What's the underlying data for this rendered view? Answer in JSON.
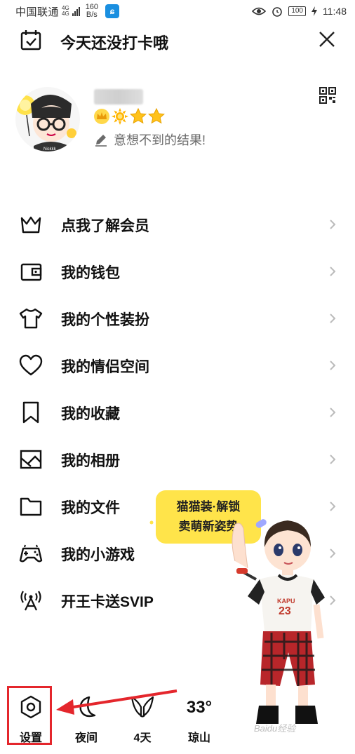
{
  "status_bar": {
    "carrier": "中国联通",
    "network_top": "4G",
    "network_bottom": "4G",
    "speed_value": "160",
    "speed_unit": "B/s",
    "battery": "100",
    "time": "11:48"
  },
  "header": {
    "checkin_text": "今天还没打卡哦"
  },
  "profile": {
    "avatar_name": "Nickkk",
    "signature": "意想不到的结果!"
  },
  "menu": {
    "items": [
      {
        "label": "点我了解会员",
        "icon": "crown-icon"
      },
      {
        "label": "我的钱包",
        "icon": "wallet-icon"
      },
      {
        "label": "我的个性装扮",
        "icon": "tshirt-icon"
      },
      {
        "label": "我的情侣空间",
        "icon": "heart-icon"
      },
      {
        "label": "我的收藏",
        "icon": "bookmark-icon"
      },
      {
        "label": "我的相册",
        "icon": "album-icon"
      },
      {
        "label": "我的文件",
        "icon": "folder-icon"
      },
      {
        "label": "我的小游戏",
        "icon": "gamepad-icon"
      },
      {
        "label": "开王卡送SVIP",
        "icon": "signal-tower-icon"
      }
    ]
  },
  "promo": {
    "line1": "猫猫装·解锁",
    "line2": "卖萌新姿势",
    "shirt_text": "KAPU",
    "shirt_number": "23"
  },
  "bottom_bar": {
    "settings_label": "设置",
    "night_label": "夜间",
    "day_label": "4天",
    "weather_temp": "33°",
    "weather_city": "琼山"
  },
  "watermark": "Baidu经验",
  "colors": {
    "highlight": "#e4262c",
    "promo_bg": "#ffe44a",
    "star": "#ffc21a"
  }
}
